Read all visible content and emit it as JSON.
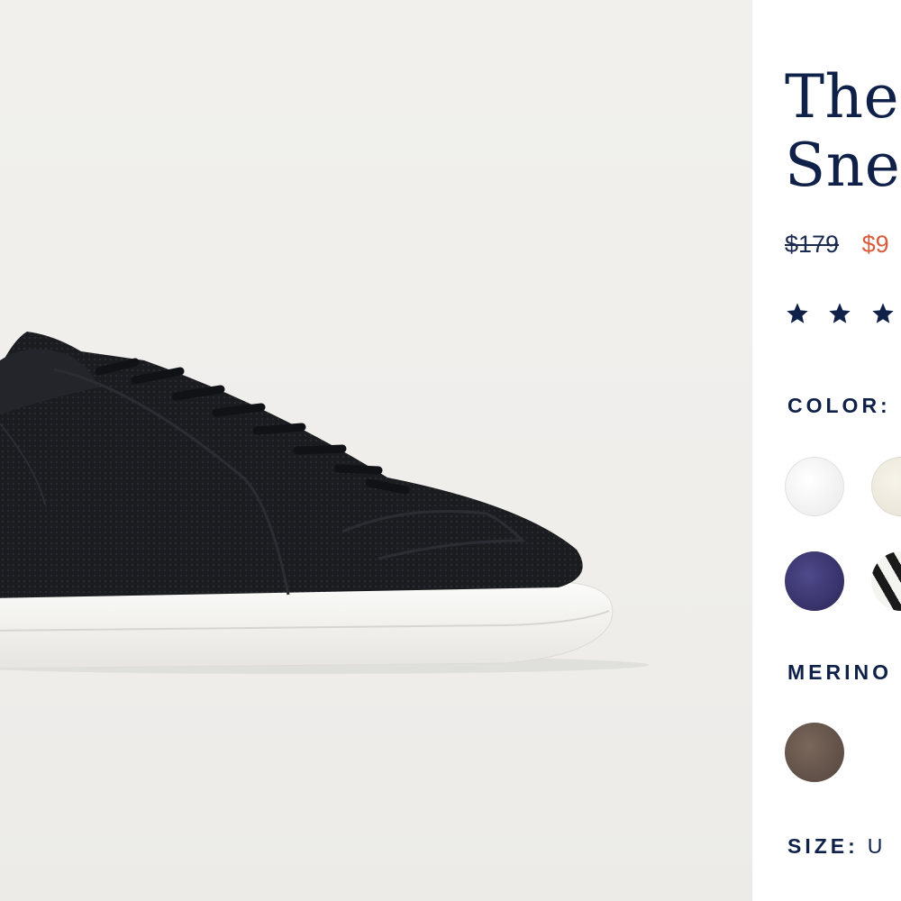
{
  "product": {
    "title_line1": "The",
    "title_line2": "Snea",
    "price_original": "$179",
    "price_sale": "$9",
    "rating_stars_visible": 3
  },
  "sections": {
    "color_label": "COLOR:",
    "merino_label": "MERINO",
    "size_label": "SIZE:",
    "size_value": "U"
  },
  "colors": {
    "sale_price": "#d95b3c",
    "brand_navy": "#0f2149",
    "page_background": "#f0efec"
  },
  "swatches": {
    "color_options": [
      "white",
      "cream",
      "navy",
      "black-white-stripe"
    ],
    "merino_options": [
      "brown"
    ]
  },
  "icons": [
    "star-icon"
  ]
}
